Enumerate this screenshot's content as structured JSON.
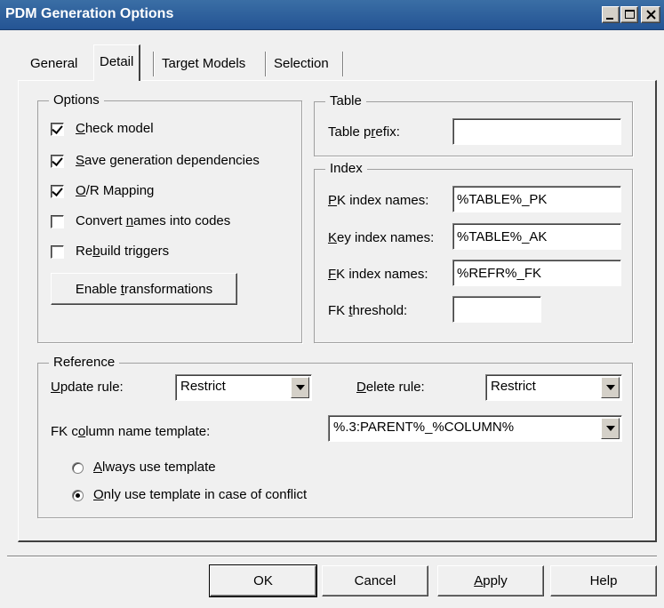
{
  "window": {
    "title": "PDM Generation Options"
  },
  "tabs": [
    {
      "label": "General"
    },
    {
      "label": "Detail"
    },
    {
      "label": "Target Models"
    },
    {
      "label": "Selection"
    }
  ],
  "options": {
    "group_label": "Options",
    "check_model": {
      "pre": "",
      "ul": "C",
      "post": "heck model",
      "checked": true
    },
    "save_generation_dependencies": {
      "pre": "",
      "ul": "S",
      "post": "ave generation dependencies",
      "checked": true
    },
    "or_mapping": {
      "pre": "",
      "ul": "O",
      "post": "/R Mapping",
      "checked": true
    },
    "convert_names": {
      "pre": "Convert ",
      "ul": "n",
      "post": "ames into codes",
      "checked": false
    },
    "rebuild_triggers": {
      "pre": "Re",
      "ul": "b",
      "post": "uild triggers",
      "checked": false
    },
    "enable_transformations": {
      "pre": "Enable ",
      "ul": "t",
      "post": "ransformations"
    }
  },
  "table": {
    "group_label": "Table",
    "prefix_label": {
      "pre": "Table p",
      "ul": "r",
      "post": "efix:"
    },
    "prefix_value": ""
  },
  "index": {
    "group_label": "Index",
    "pk_label": {
      "pre": "",
      "ul": "P",
      "post": "K index names:"
    },
    "pk_value": "%TABLE%_PK",
    "key_label": {
      "pre": "",
      "ul": "K",
      "post": "ey index names:"
    },
    "key_value": "%TABLE%_AK",
    "fk_label": {
      "pre": "",
      "ul": "F",
      "post": "K index names:"
    },
    "fk_value": "%REFR%_FK",
    "threshold_label": {
      "pre": "FK ",
      "ul": "t",
      "post": "hreshold:"
    },
    "threshold_value": ""
  },
  "reference": {
    "group_label": "Reference",
    "update_label": {
      "pre": "",
      "ul": "U",
      "post": "pdate rule:"
    },
    "update_value": "Restrict",
    "delete_label": {
      "pre": "",
      "ul": "D",
      "post": "elete rule:"
    },
    "delete_value": "Restrict",
    "fk_template_label": {
      "pre": "FK c",
      "ul": "o",
      "post": "lumn name template:"
    },
    "fk_template_value": "%.3:PARENT%_%COLUMN%",
    "always_use": {
      "pre": "",
      "ul": "A",
      "post": "lways use template",
      "checked": false
    },
    "only_use": {
      "pre": "",
      "ul": "O",
      "post": "nly use template in case of conflict",
      "checked": true
    }
  },
  "buttons": {
    "ok": {
      "pre": "OK",
      "ul": "",
      "post": ""
    },
    "cancel": {
      "pre": "Cancel",
      "ul": "",
      "post": ""
    },
    "apply": {
      "pre": "",
      "ul": "A",
      "post": "pply"
    },
    "help": {
      "pre": "Help",
      "ul": "",
      "post": ""
    }
  },
  "colors": {
    "titlebar": "#245494",
    "dialog_bg": "#f0f0f0"
  }
}
